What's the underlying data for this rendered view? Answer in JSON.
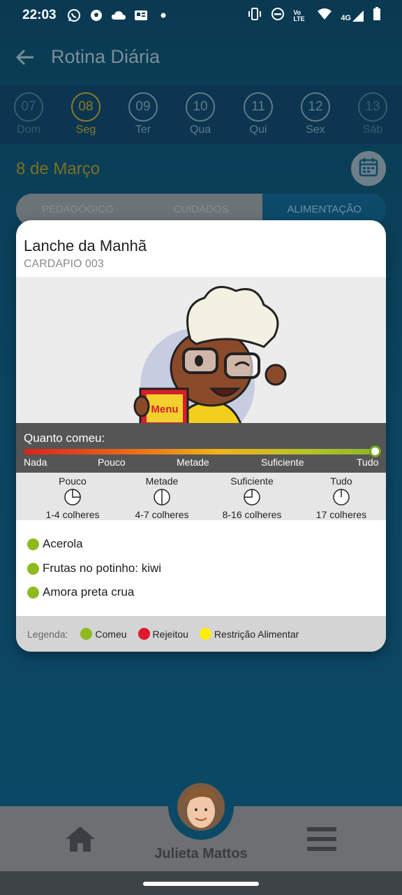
{
  "status_bar": {
    "time": "22:03",
    "left_icons": [
      "whatsapp-icon",
      "soccer-ball-icon",
      "cloud-icon",
      "news-icon",
      "dot-icon"
    ],
    "right_icons": [
      "vibrate-icon",
      "do-not-disturb-icon",
      "volte-icon",
      "wifi-icon",
      "4g-signal-icon",
      "battery-icon"
    ],
    "volte": "Vo LTE",
    "network": "4G"
  },
  "header": {
    "title": "Rotina Diária"
  },
  "date_strip": {
    "days": [
      {
        "num": "07",
        "label": "Dom"
      },
      {
        "num": "08",
        "label": "Seg",
        "active": true
      },
      {
        "num": "09",
        "label": "Ter"
      },
      {
        "num": "10",
        "label": "Qua"
      },
      {
        "num": "11",
        "label": "Qui"
      },
      {
        "num": "12",
        "label": "Sex"
      },
      {
        "num": "13",
        "label": "Sáb"
      }
    ]
  },
  "date_heading": "8 de Março",
  "tabs": [
    {
      "label": "PEDAGÓGICO"
    },
    {
      "label": "CUIDADOS"
    },
    {
      "label": "ALIMENTAÇÃO",
      "active": true
    }
  ],
  "meal_card": {
    "title": "Lanche da Manhã",
    "subtitle": "CARDAPIO 003",
    "illustration_menu_text": "Menu",
    "amount": {
      "title": "Quanto comeu:",
      "labels": [
        "Nada",
        "Pouco",
        "Metade",
        "Suficiente",
        "Tudo"
      ],
      "selected": "Tudo",
      "level_fraction": 1.0
    },
    "portions": [
      {
        "name": "Pouco",
        "spoons": "1-4 colheres",
        "fraction": 0.25
      },
      {
        "name": "Metade",
        "spoons": "4-7 colheres",
        "fraction": 0.5
      },
      {
        "name": "Suficiente",
        "spoons": "8-16 colheres",
        "fraction": 0.75
      },
      {
        "name": "Tudo",
        "spoons": "17 colheres",
        "fraction": 1.0
      }
    ],
    "foods": [
      {
        "name": "Acerola",
        "status": "Comeu"
      },
      {
        "name": "Frutas no potinho: kiwi",
        "status": "Comeu"
      },
      {
        "name": "Amora preta crua",
        "status": "Comeu"
      }
    ],
    "legend": {
      "title": "Legenda:",
      "items": [
        {
          "label": "Comeu",
          "color": "#8dbb1f"
        },
        {
          "label": "Rejeitou",
          "color": "#e0182d"
        },
        {
          "label": "Restrição Alimentar",
          "color": "#ffee00"
        }
      ]
    }
  },
  "bottom_nav": {
    "student_name": "Julieta Mattos",
    "home_icon": "home-icon",
    "menu_icon": "hamburger-menu-icon"
  },
  "colors": {
    "eaten": "#8dbb1f",
    "background": "#0b4966",
    "active_day": "#8a7a2a"
  }
}
